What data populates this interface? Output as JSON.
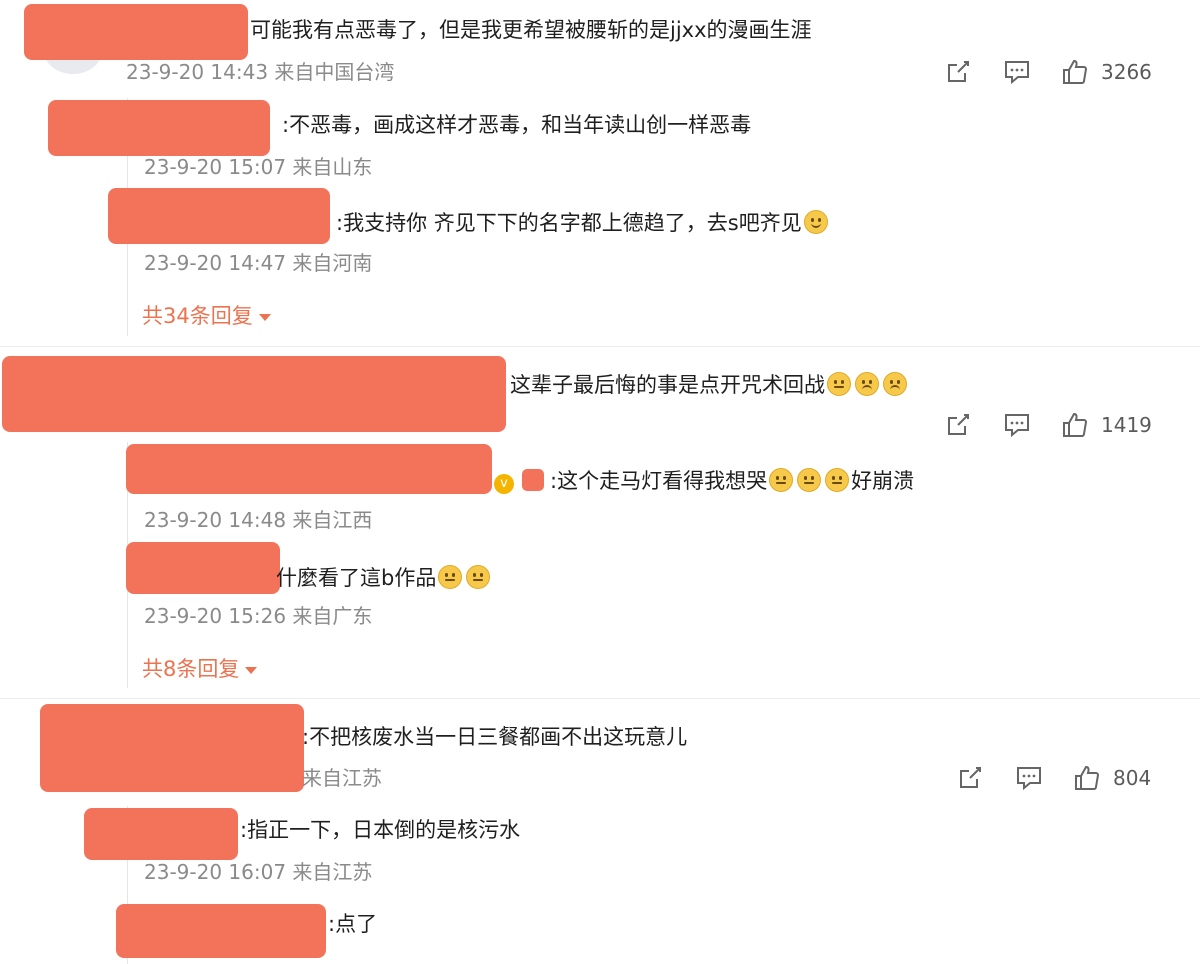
{
  "comments": [
    {
      "text": "可能我有点恶毒了，但是我更希望被腰斩的是jjxx的漫画生涯",
      "meta": "23-9-20 14:43 来自中国台湾",
      "likes": "3266",
      "replies": [
        {
          "text": ":不恶毒，画成这样才恶毒，和当年读山创一样恶毒",
          "meta": "23-9-20 15:07 来自山东"
        },
        {
          "text": ":我支持你     齐见下下的名字都上德趋了，去s吧齐见",
          "meta": "23-9-20 14:47 来自河南"
        }
      ],
      "more": "共34条回复"
    },
    {
      "text": "这辈子最后悔的事是点开咒术回战",
      "meta": "",
      "likes": "1419",
      "replies": [
        {
          "text": ":这个走马灯看得我想哭",
          "text2": "好崩溃",
          "meta": "23-9-20 14:48 来自江西"
        },
        {
          "text": "什麼看了這b作品",
          "meta": "23-9-20 15:26 来自广东"
        }
      ],
      "more": "共8条回复"
    },
    {
      "text": ":不把核废水当一日三餐都画不出这玩意儿",
      "meta": "来自江苏",
      "likes": "804",
      "replies": [
        {
          "text": ":指正一下，日本倒的是核污水",
          "meta": "23-9-20 16:07 来自江苏"
        },
        {
          "text": ":点了",
          "meta": ""
        }
      ]
    }
  ],
  "colors": {
    "redaction": "#f3735a",
    "more_link": "#eb7350",
    "meta_text": "#8a8a8a"
  },
  "icons": [
    "share-icon",
    "comment-icon",
    "like-icon"
  ]
}
